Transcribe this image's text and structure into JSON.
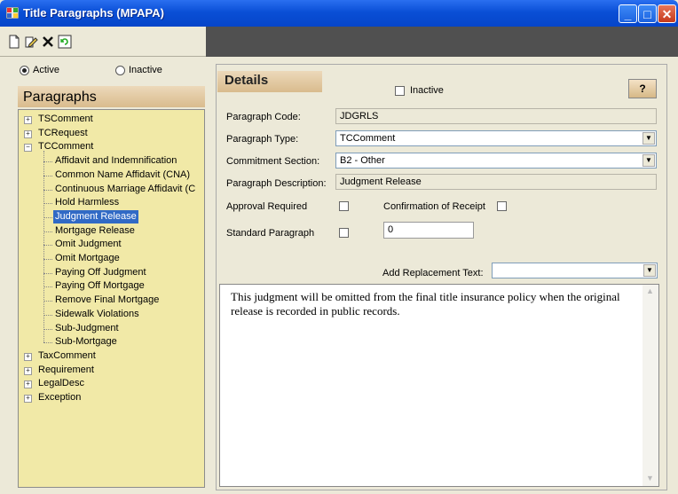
{
  "window": {
    "title": "Title Paragraphs (MPAPA)"
  },
  "toolbar": {
    "icons": [
      "new-document-icon",
      "edit-icon",
      "delete-icon",
      "refresh-icon"
    ]
  },
  "filter": {
    "active_label": "Active",
    "inactive_label": "Inactive",
    "selected": "Active"
  },
  "paragraphs": {
    "header": "Paragraphs",
    "tree": [
      {
        "label": "TSComment",
        "expanded": false
      },
      {
        "label": "TCRequest",
        "expanded": false
      },
      {
        "label": "TCComment",
        "expanded": true,
        "children": [
          "Affidavit and Indemnification",
          "Common Name Affidavit (CNA)",
          "Continuous Marriage Affidavit (C",
          "Hold Harmless",
          "Judgment Release",
          "Mortgage Release",
          "Omit Judgment",
          "Omit Mortgage",
          "Paying Off Judgment",
          "Paying Off Mortgage",
          "Remove Final Mortgage",
          "Sidewalk Violations",
          "Sub-Judgment",
          "Sub-Mortgage"
        ]
      },
      {
        "label": "TaxComment",
        "expanded": false
      },
      {
        "label": "Requirement",
        "expanded": false
      },
      {
        "label": "LegalDesc",
        "expanded": false
      },
      {
        "label": "Exception",
        "expanded": false
      }
    ],
    "selected_child": "Judgment Release"
  },
  "details": {
    "header": "Details",
    "inactive_label": "Inactive",
    "help_label": "?",
    "code_label": "Paragraph Code:",
    "code_value": "JDGRLS",
    "type_label": "Paragraph Type:",
    "type_value": "TCComment",
    "section_label": "Commitment Section:",
    "section_value": "B2 - Other",
    "desc_label": "Paragraph Description:",
    "desc_value": "Judgment Release",
    "approval_label": "Approval Required",
    "confirmation_label": "Confirmation of Receipt",
    "standard_label": "Standard Paragraph",
    "standard_value": "0",
    "replacement_label": "Add Replacement Text:",
    "replacement_value": "",
    "text": "This judgment will be omitted from the final title insurance policy when the original release is recorded in public records."
  }
}
